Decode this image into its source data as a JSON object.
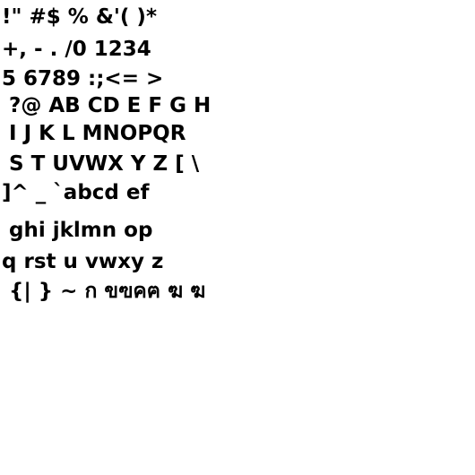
{
  "lines": [
    "!\" #$ % &'( )*",
    "+, - . /0 1234",
    "5 6789 :;<= >",
    " ?@ AB CD E F G H",
    " I J K L MNOPQR",
    " S T UVWX Y Z [ \\",
    "]^ _ `abcd ef",
    " ghi jklmn op",
    "q rst u vwxy z",
    " {| } ~ ก ขฃคฅ ฆ ฆ"
  ]
}
